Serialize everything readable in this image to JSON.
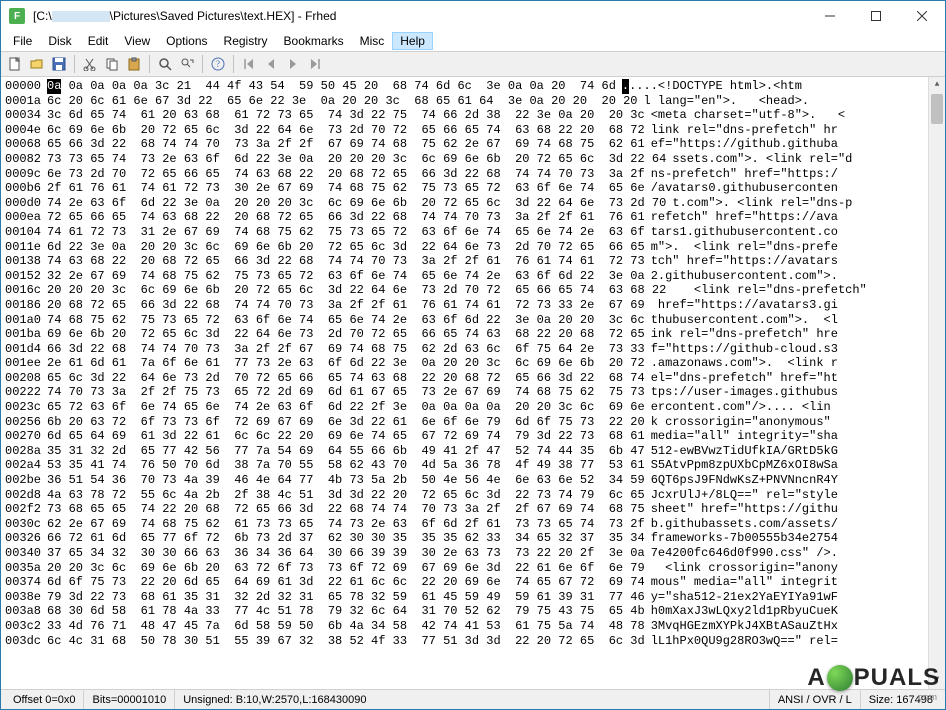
{
  "window": {
    "title_prefix": "[C:\\",
    "title_redacted_width": 58,
    "title_suffix": "\\Pictures\\Saved Pictures\\text.HEX] - Frhed",
    "app_icon_letter": "F"
  },
  "menu": {
    "items": [
      "File",
      "Disk",
      "Edit",
      "View",
      "Options",
      "Registry",
      "Bookmarks",
      "Misc",
      "Help"
    ],
    "highlighted": "Help"
  },
  "toolbar": {
    "groups": [
      [
        "new-icon",
        "open-icon",
        "save-icon"
      ],
      [
        "cut-icon",
        "copy-icon",
        "paste-icon"
      ],
      [
        "find-icon",
        "replace-icon"
      ],
      [
        "help-icon"
      ],
      [
        "first-icon",
        "prev-icon",
        "next-icon",
        "last-icon"
      ]
    ]
  },
  "hex": {
    "lines": [
      {
        "off": "00000",
        "hex": "0a 0a 0a 0a 0a 3c 21  44 4f 43 54  59 50 45 20  68 74 6d 6c  3e 0a 0a 20  74 6d",
        "asc": ".....<!DOCTYPE html>.<htm"
      },
      {
        "off": "0001a",
        "hex": "6c 20 6c 61 6e 67 3d 22  65 6e 22 3e  0a 20 20 3c  68 65 61 64  3e 0a 20 20  20 20",
        "asc": "l lang=\"en\">.   <head>.   "
      },
      {
        "off": "00034",
        "hex": "3c 6d 65 74  61 20 63 68  61 72 73 65  74 3d 22 75  74 66 2d 38  22 3e 0a 20  20 3c",
        "asc": "<meta charset=\"utf-8\">.   <"
      },
      {
        "off": "0004e",
        "hex": "6c 69 6e 6b  20 72 65 6c  3d 22 64 6e  73 2d 70 72  65 66 65 74  63 68 22 20  68 72",
        "asc": "link rel=\"dns-prefetch\" hr"
      },
      {
        "off": "00068",
        "hex": "65 66 3d 22  68 74 74 70  73 3a 2f 2f  67 69 74 68  75 62 2e 67  69 74 68 75  62 61",
        "asc": "ef=\"https://github.githuba"
      },
      {
        "off": "00082",
        "hex": "73 73 65 74  73 2e 63 6f  6d 22 3e 0a  20 20 20 3c  6c 69 6e 6b  20 72 65 6c  3d 22 64",
        "asc": "ssets.com\">. <link rel=\"d"
      },
      {
        "off": "0009c",
        "hex": "6e 73 2d 70  72 65 66 65  74 63 68 22  20 68 72 65  66 3d 22 68  74 74 70 73  3a 2f",
        "asc": "ns-prefetch\" href=\"https:/"
      },
      {
        "off": "000b6",
        "hex": "2f 61 76 61  74 61 72 73  30 2e 67 69  74 68 75 62  75 73 65 72  63 6f 6e 74  65 6e",
        "asc": "/avatars0.githubuserconten"
      },
      {
        "off": "000d0",
        "hex": "74 2e 63 6f  6d 22 3e 0a  20 20 20 3c  6c 69 6e 6b  20 72 65 6c  3d 22 64 6e  73 2d 70",
        "asc": "t.com\">. <link rel=\"dns-p"
      },
      {
        "off": "000ea",
        "hex": "72 65 66 65  74 63 68 22  20 68 72 65  66 3d 22 68  74 74 70 73  3a 2f 2f 61  76 61",
        "asc": "refetch\" href=\"https://ava"
      },
      {
        "off": "00104",
        "hex": "74 61 72 73  31 2e 67 69  74 68 75 62  75 73 65 72  63 6f 6e 74  65 6e 74 2e  63 6f",
        "asc": "tars1.githubusercontent.co"
      },
      {
        "off": "0011e",
        "hex": "6d 22 3e 0a  20 20 3c 6c  69 6e 6b 20  72 65 6c 3d  22 64 6e 73  2d 70 72 65  66 65",
        "asc": "m\">.  <link rel=\"dns-prefe"
      },
      {
        "off": "00138",
        "hex": "74 63 68 22  20 68 72 65  66 3d 22 68  74 74 70 73  3a 2f 2f 61  76 61 74 61  72 73",
        "asc": "tch\" href=\"https://avatars"
      },
      {
        "off": "00152",
        "hex": "32 2e 67 69  74 68 75 62  75 73 65 72  63 6f 6e 74  65 6e 74 2e  63 6f 6d 22  3e 0a",
        "asc": "2.githubusercontent.com\">."
      },
      {
        "off": "0016c",
        "hex": "20 20 20 3c  6c 69 6e 6b  20 72 65 6c  3d 22 64 6e  73 2d 70 72  65 66 65 74  63 68 22",
        "asc": "   <link rel=\"dns-prefetch\""
      },
      {
        "off": "00186",
        "hex": "20 68 72 65  66 3d 22 68  74 74 70 73  3a 2f 2f 61  76 61 74 61  72 73 33 2e  67 69",
        "asc": " href=\"https://avatars3.gi"
      },
      {
        "off": "001a0",
        "hex": "74 68 75 62  75 73 65 72  63 6f 6e 74  65 6e 74 2e  63 6f 6d 22  3e 0a 20 20  3c 6c",
        "asc": "thubusercontent.com\">.  <l"
      },
      {
        "off": "001ba",
        "hex": "69 6e 6b 20  72 65 6c 3d  22 64 6e 73  2d 70 72 65  66 65 74 63  68 22 20 68  72 65",
        "asc": "ink rel=\"dns-prefetch\" hre"
      },
      {
        "off": "001d4",
        "hex": "66 3d 22 68  74 74 70 73  3a 2f 2f 67  69 74 68 75  62 2d 63 6c  6f 75 64 2e  73 33",
        "asc": "f=\"https://github-cloud.s3"
      },
      {
        "off": "001ee",
        "hex": "2e 61 6d 61  7a 6f 6e 61  77 73 2e 63  6f 6d 22 3e  0a 20 20 3c  6c 69 6e 6b  20 72",
        "asc": ".amazonaws.com\">.  <link r"
      },
      {
        "off": "00208",
        "hex": "65 6c 3d 22  64 6e 73 2d  70 72 65 66  65 74 63 68  22 20 68 72  65 66 3d 22  68 74",
        "asc": "el=\"dns-prefetch\" href=\"ht"
      },
      {
        "off": "00222",
        "hex": "74 70 73 3a  2f 2f 75 73  65 72 2d 69  6d 61 67 65  73 2e 67 69  74 68 75 62  75 73",
        "asc": "tps://user-images.githubus"
      },
      {
        "off": "0023c",
        "hex": "65 72 63 6f  6e 74 65 6e  74 2e 63 6f  6d 22 2f 3e  0a 0a 0a 0a  20 20 3c 6c  69 6e",
        "asc": "ercontent.com\"/>.... <lin"
      },
      {
        "off": "00256",
        "hex": "6b 20 63 72  6f 73 73 6f  72 69 67 69  6e 3d 22 61  6e 6f 6e 79  6d 6f 75 73  22 20",
        "asc": "k crossorigin=\"anonymous\" "
      },
      {
        "off": "00270",
        "hex": "6d 65 64 69  61 3d 22 61  6c 6c 22 20  69 6e 74 65  67 72 69 74  79 3d 22 73  68 61",
        "asc": "media=\"all\" integrity=\"sha"
      },
      {
        "off": "0028a",
        "hex": "35 31 32 2d  65 77 42 56  77 7a 54 69  64 55 66 6b  49 41 2f 47  52 74 44 35  6b 47",
        "asc": "512-ewBVwzTidUfkIA/GRtD5kG"
      },
      {
        "off": "002a4",
        "hex": "53 35 41 74  76 50 70 6d  38 7a 70 55  58 62 43 70  4d 5a 36 78  4f 49 38 77  53 61",
        "asc": "S5AtvPpm8zpUXbCpMZ6xOI8wSa"
      },
      {
        "off": "002be",
        "hex": "36 51 54 36  70 73 4a 39  46 4e 64 77  4b 73 5a 2b  50 4e 56 4e  6e 63 6e 52  34 59",
        "asc": "6QT6psJ9FNdwKsZ+PNVNncnR4Y"
      },
      {
        "off": "002d8",
        "hex": "4a 63 78 72  55 6c 4a 2b  2f 38 4c 51  3d 3d 22 20  72 65 6c 3d  22 73 74 79  6c 65",
        "asc": "JcxrUlJ+/8LQ==\" rel=\"style"
      },
      {
        "off": "002f2",
        "hex": "73 68 65 65  74 22 20 68  72 65 66 3d  22 68 74 74  70 73 3a 2f  2f 67 69 74  68 75",
        "asc": "sheet\" href=\"https://githu"
      },
      {
        "off": "0030c",
        "hex": "62 2e 67 69  74 68 75 62  61 73 73 65  74 73 2e 63  6f 6d 2f 61  73 73 65 74  73 2f",
        "asc": "b.githubassets.com/assets/"
      },
      {
        "off": "00326",
        "hex": "66 72 61 6d  65 77 6f 72  6b 73 2d 37  62 30 30 35  35 35 62 33  34 65 32 37  35 34",
        "asc": "frameworks-7b00555b34e2754"
      },
      {
        "off": "00340",
        "hex": "37 65 34 32  30 30 66 63  36 34 36 64  30 66 39 39  30 2e 63 73  73 22 20 2f  3e 0a",
        "asc": "7e4200fc646d0f990.css\" />."
      },
      {
        "off": "0035a",
        "hex": "20 20 3c 6c  69 6e 6b 20  63 72 6f 73  73 6f 72 69  67 69 6e 3d  22 61 6e 6f  6e 79",
        "asc": "  <link crossorigin=\"anony"
      },
      {
        "off": "00374",
        "hex": "6d 6f 75 73  22 20 6d 65  64 69 61 3d  22 61 6c 6c  22 20 69 6e  74 65 67 72  69 74",
        "asc": "mous\" media=\"all\" integrit"
      },
      {
        "off": "0038e",
        "hex": "79 3d 22 73  68 61 35 31  32 2d 32 31  65 78 32 59  61 45 59 49  59 61 39 31  77 46",
        "asc": "y=\"sha512-21ex2YaEYIYa91wF"
      },
      {
        "off": "003a8",
        "hex": "68 30 6d 58  61 78 4a 33  77 4c 51 78  79 32 6c 64  31 70 52 62  79 75 43 75  65 4b",
        "asc": "h0mXaxJ3wLQxy2ld1pRbyuCueK"
      },
      {
        "off": "003c2",
        "hex": "33 4d 76 71  48 47 45 7a  6d 58 59 50  6b 4a 34 58  42 74 41 53  61 75 5a 74  48 78",
        "asc": "3MvqHGEzmXYPkJ4XBtASauZtHx"
      },
      {
        "off": "003dc",
        "hex": "6c 4c 31 68  50 78 30 51  55 39 67 32  38 52 4f 33  77 51 3d 3d  22 20 72 65  6c 3d",
        "asc": "lL1hPx0QU9g28RO3wQ==\" rel="
      }
    ]
  },
  "status": {
    "offset": "Offset 0=0x0",
    "bits": "Bits=00001010",
    "unsigned": "Unsigned: B:10,W:2570,L:168430090",
    "mode": "ANSI / OVR / L",
    "size": "Size: 167498"
  },
  "watermark": {
    "pre": "A",
    "post": "PUALS",
    "sub": ".com"
  }
}
